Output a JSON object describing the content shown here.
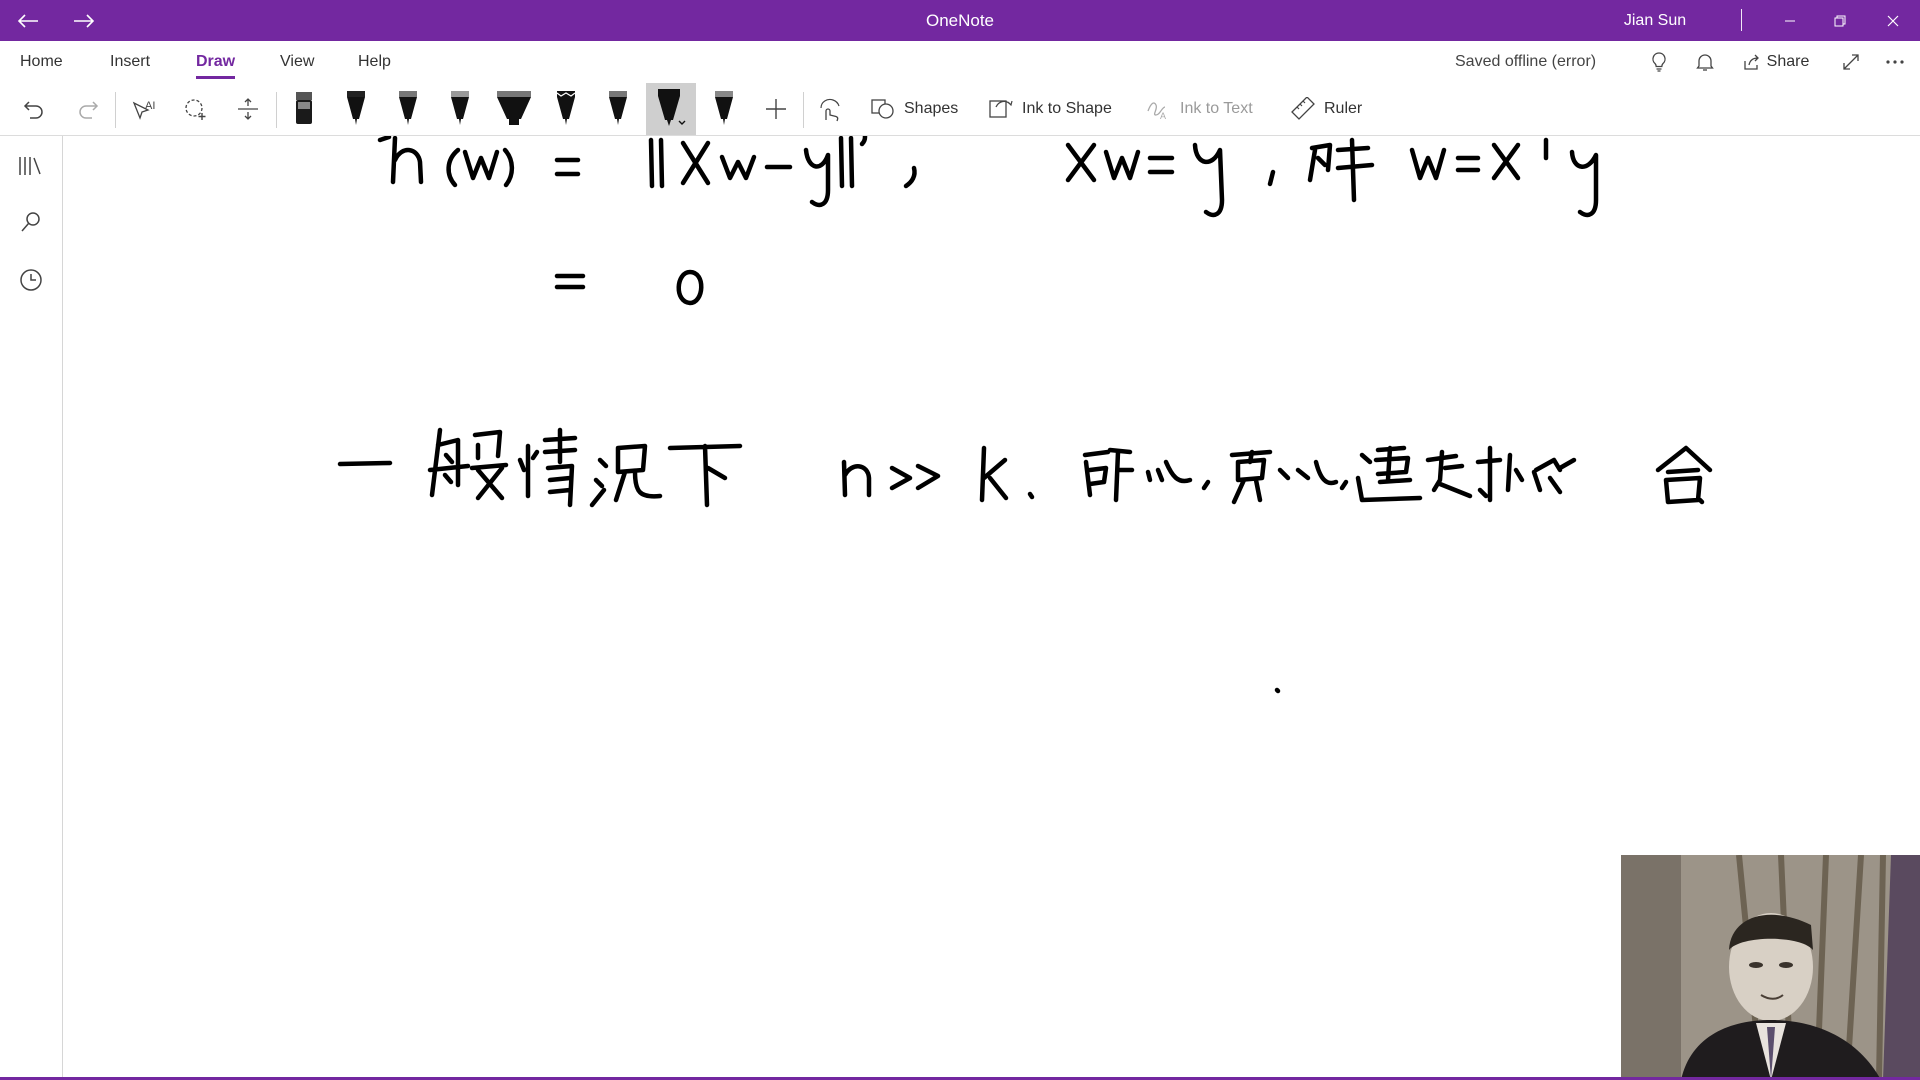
{
  "app": {
    "title": "OneNote",
    "user": "Jian Sun"
  },
  "menu": {
    "tabs": [
      "Home",
      "Insert",
      "Draw",
      "View",
      "Help"
    ],
    "active_tab": "Draw",
    "status": "Saved offline (error)",
    "share_label": "Share"
  },
  "toolbar": {
    "shapes_label": "Shapes",
    "ink_to_shape_label": "Ink to Shape",
    "ink_to_text_label": "Ink to Text",
    "ruler_label": "Ruler"
  },
  "ink": {
    "line1": "h(w) = ||Xw − y||²,    Xw = y，解 w = X⁻¹y",
    "line2": "= 0",
    "line3": "一般情况下  n >> k. 所以，可以，避免过拟合."
  },
  "colors": {
    "accent": "#7328a0",
    "ink": "#000000"
  }
}
